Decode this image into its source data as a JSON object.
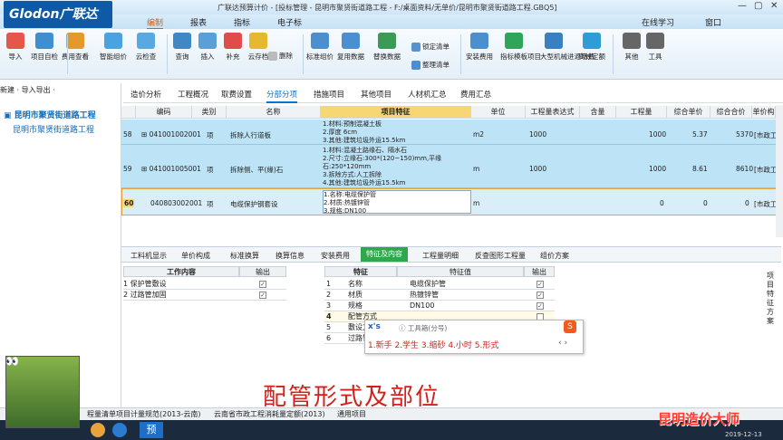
{
  "app": {
    "logo": "Glodon广联达",
    "title": "广联达预算计价 - [投标管理 - 昆明市聚贤街道路工程 - F:/桌面资料/无单价/昆明市聚贤街道路工程.GBQ5]",
    "online_study": "在线学习",
    "window_menu": "窗口"
  },
  "menu": {
    "items": [
      "编制",
      "报表",
      "指标",
      "电子标"
    ],
    "active": "编制"
  },
  "ribbon": {
    "buttons": [
      {
        "label": "导入",
        "icon": "import-icon",
        "color": "#e6564a"
      },
      {
        "label": "项目自检",
        "icon": "check-icon",
        "color": "#3e8ed0"
      },
      {
        "label": "费用查看",
        "icon": "cost-view-icon",
        "color": "#e49a2a"
      },
      {
        "label": "智能组价",
        "icon": "smart-price-icon",
        "color": "#4aa3df"
      },
      {
        "label": "云检查",
        "icon": "cloud-check-icon",
        "color": "#59a8e0"
      },
      {
        "label": "查询",
        "icon": "query-icon",
        "color": "#3f88c5"
      },
      {
        "label": "插入",
        "icon": "insert-icon",
        "color": "#5aa0d8"
      },
      {
        "label": "补充",
        "icon": "supplement-icon",
        "color": "#e04b4b"
      },
      {
        "label": "云存档",
        "icon": "cloud-save-icon",
        "color": "#e5b92e"
      },
      {
        "label": "标准组价",
        "icon": "standard-price-icon",
        "color": "#4c8fcf"
      },
      {
        "label": "复用数据",
        "icon": "reuse-data-icon",
        "color": "#4c8fcf"
      },
      {
        "label": "替换数据",
        "icon": "replace-data-icon",
        "color": "#3a9a56"
      },
      {
        "label": "安装费用",
        "icon": "install-cost-icon",
        "color": "#4c8fcf"
      },
      {
        "label": "指标模板项目",
        "icon": "template-icon",
        "color": "#2fa55a"
      },
      {
        "label": "大型机械进退场费",
        "icon": "machine-icon",
        "color": "#3a7fbf"
      },
      {
        "label": "高效定额",
        "icon": "quota-icon",
        "color": "#2f9cd6"
      },
      {
        "label": "其他",
        "icon": "other-icon",
        "color": "#666666"
      },
      {
        "label": "工具",
        "icon": "tools-icon",
        "color": "#666666"
      }
    ],
    "small": {
      "delete": "删除",
      "lock": "锁定清单",
      "organize": "整理清单"
    }
  },
  "tree": {
    "toolbar": "新建 · 导入导出 ·",
    "root": "昆明市聚贤街道路工程",
    "child": "昆明市聚贤街道路工程"
  },
  "tabs": {
    "items": [
      "造价分析",
      "工程概况",
      "取费设置",
      "分部分项",
      "措施项目",
      "其他项目",
      "人材机汇总",
      "费用汇总"
    ],
    "active": "分部分项"
  },
  "grid": {
    "headers": [
      "编码",
      "类别",
      "名称",
      "项目特征",
      "单位",
      "工程量表达式",
      "含量",
      "工程量",
      "综合单价",
      "综合合价",
      "单价构"
    ],
    "rows": [
      {
        "num": "58",
        "code": "041001002001",
        "type": "项",
        "name": "拆除人行道板",
        "features": "1.材料:预制混凝土板\n2.厚度 6cm\n3.其他:建筑垃圾外运15.5km",
        "unit": "m2",
        "expr": "1000",
        "qty": "1000",
        "price": "5.37",
        "total": "5370",
        "build": "[市政工"
      },
      {
        "num": "59",
        "code": "041001005001",
        "type": "项",
        "name": "拆除侧、平(缘)石",
        "features": "1.材料:混凝土路缘石、隔水石\n2.尺寸:立缘石:300*(120~150)mm,平缘\n石:250*120mm\n3.拆除方式:人工拆除\n4.其他:建筑垃圾外运15.5km",
        "unit": "m",
        "expr": "1000",
        "qty": "1000",
        "price": "8.61",
        "total": "8610",
        "build": "[市政工"
      },
      {
        "num": "60",
        "code": "040803002001",
        "type": "项",
        "name": "电缆保护钢套设",
        "features": "1.名称:电缆保护管\n2.材质:热镀锌管\n3.规格:DN100",
        "unit": "m",
        "expr": "",
        "qty": "0",
        "price": "0",
        "total": "0",
        "build": "[市政工"
      }
    ]
  },
  "bottom_tabs": {
    "items": [
      "工料机显示",
      "单价构成",
      "标准换算",
      "换算信息",
      "安装费用",
      "特征及内容",
      "工程量明细",
      "反查图形工程量",
      "组价方案"
    ],
    "active": "特征及内容"
  },
  "work": {
    "header": "工作内容",
    "output_header": "输出",
    "rows": [
      {
        "num": "1",
        "text": "保护管敷设",
        "checked": true
      },
      {
        "num": "2",
        "text": "过路管加固",
        "checked": true
      }
    ]
  },
  "features": {
    "headers": [
      "特征",
      "特征值",
      "输出"
    ],
    "rows": [
      {
        "num": "1",
        "name": "名称",
        "value": "电缆保护管",
        "checked": true
      },
      {
        "num": "2",
        "name": "材质",
        "value": "热镀锌管",
        "checked": true
      },
      {
        "num": "3",
        "name": "规格",
        "value": "DN100",
        "checked": true
      },
      {
        "num": "4",
        "name": "配管方式",
        "value": "",
        "checked": false
      },
      {
        "num": "5",
        "name": "敷设方式",
        "value": "",
        "checked": false
      },
      {
        "num": "6",
        "name": "过路管加固",
        "value": "",
        "checked": false
      }
    ]
  },
  "ime": {
    "input": "x's",
    "hint": "工具箱(分号)",
    "candidates": "1.新手  2.学生  3.缩砂  4.小时  5.形式"
  },
  "right_panel": "项目特征方案",
  "subtitle": "配管形式及部位",
  "status": {
    "items": [
      "程量清单项目计量规范(2013-云南)",
      "云南省市政工程消耗量定额(2013)",
      "通用项目"
    ]
  },
  "watermark": "昆明造价大师",
  "clock": "2019-12-13"
}
